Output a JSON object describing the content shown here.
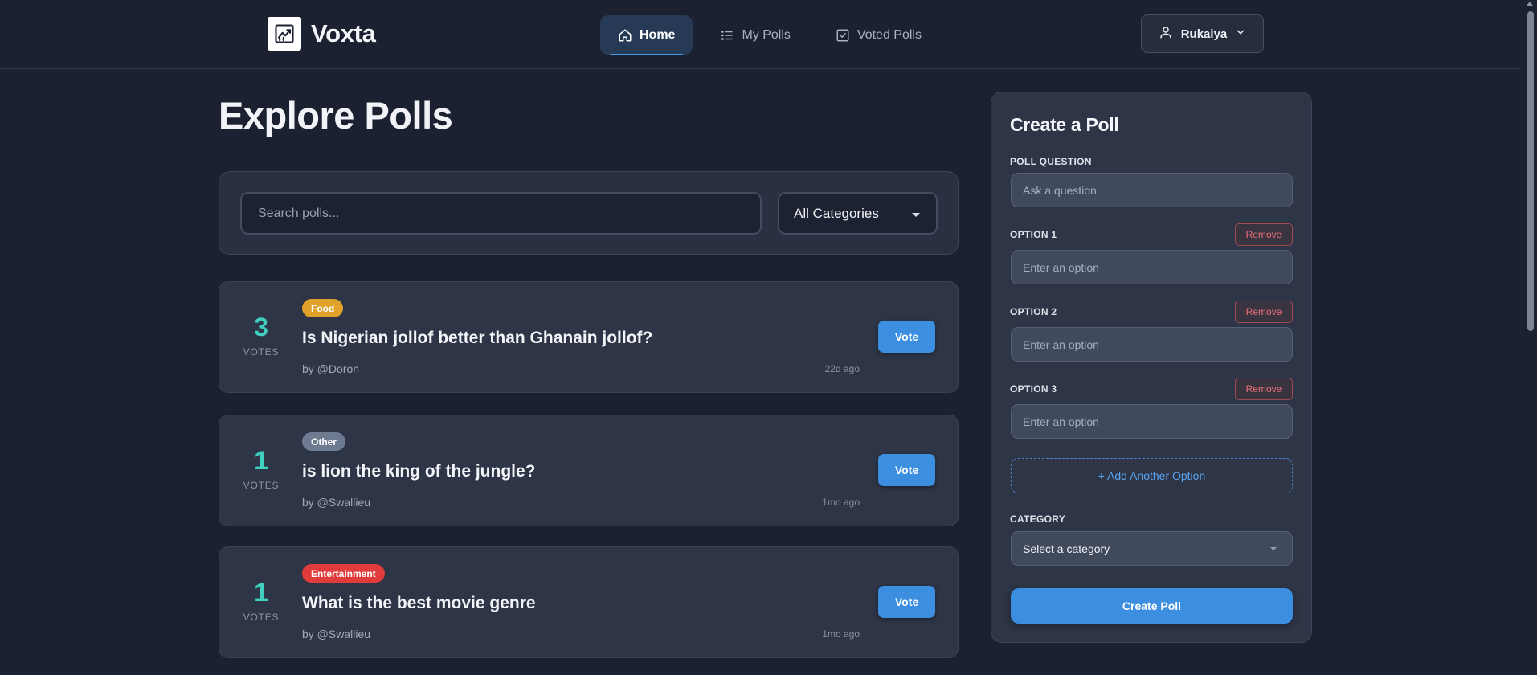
{
  "brand": {
    "name": "Voxta",
    "icon": "chart-trend-icon"
  },
  "nav": {
    "items": [
      {
        "label": "Home",
        "icon": "home-icon",
        "active": true
      },
      {
        "label": "My Polls",
        "icon": "list-icon",
        "active": false
      },
      {
        "label": "Voted Polls",
        "icon": "checkbox-icon",
        "active": false
      }
    ]
  },
  "user": {
    "name": "Rukaiya",
    "icon": "user-icon"
  },
  "main": {
    "title": "Explore Polls",
    "search": {
      "placeholder": "Search polls...",
      "value": ""
    },
    "category_filter": {
      "selected": "All Categories"
    }
  },
  "polls": [
    {
      "votes": "3",
      "votes_label": "VOTES",
      "category": "Food",
      "category_color": "#e0a22a",
      "question": "Is Nigerian jollof better than Ghanain jollof?",
      "author": "by @Doron",
      "time": "22d ago",
      "vote_label": "Vote"
    },
    {
      "votes": "1",
      "votes_label": "VOTES",
      "category": "Other",
      "category_color": "#6e7a8f",
      "question": "is lion the king of the jungle?",
      "author": "by @Swallieu",
      "time": "1mo ago",
      "vote_label": "Vote"
    },
    {
      "votes": "1",
      "votes_label": "VOTES",
      "category": "Entertainment",
      "category_color": "#e23b3b",
      "question": "What is the best movie genre",
      "author": "by @Swallieu",
      "time": "1mo ago",
      "vote_label": "Vote"
    }
  ],
  "create_poll": {
    "title": "Create a Poll",
    "question_label": "POLL QUESTION",
    "question_placeholder": "Ask a question",
    "options": [
      {
        "label": "OPTION 1",
        "placeholder": "Enter an option",
        "remove_label": "Remove"
      },
      {
        "label": "OPTION 2",
        "placeholder": "Enter an option",
        "remove_label": "Remove"
      },
      {
        "label": "OPTION 3",
        "placeholder": "Enter an option",
        "remove_label": "Remove"
      }
    ],
    "add_option_label": "+ Add Another Option",
    "category_label": "CATEGORY",
    "category_placeholder": "Select a category",
    "submit_label": "Create Poll"
  },
  "colors": {
    "accent": "#3b8ee0",
    "vote_count": "#3fd0c0",
    "danger": "#ec7078",
    "background": "#1b2130"
  }
}
